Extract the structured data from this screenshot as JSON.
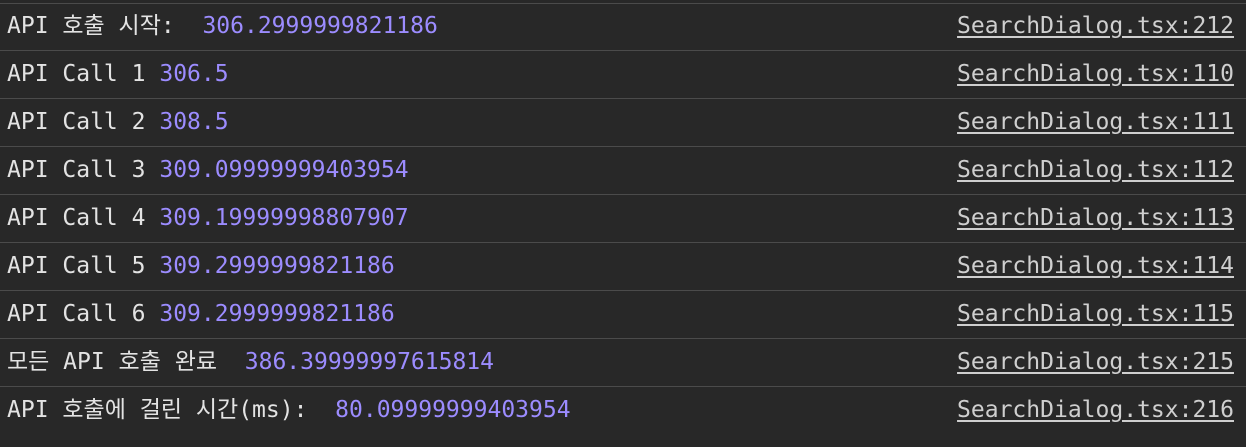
{
  "console": {
    "rows": [
      {
        "label": "API 호출 시작: ",
        "value": "306.2999999821186",
        "source": "SearchDialog.tsx:212"
      },
      {
        "label": "API Call 1",
        "value": "306.5",
        "source": "SearchDialog.tsx:110"
      },
      {
        "label": "API Call 2",
        "value": "308.5",
        "source": "SearchDialog.tsx:111"
      },
      {
        "label": "API Call 3",
        "value": "309.09999999403954",
        "source": "SearchDialog.tsx:112"
      },
      {
        "label": "API Call 4",
        "value": "309.19999998807907",
        "source": "SearchDialog.tsx:113"
      },
      {
        "label": "API Call 5",
        "value": "309.2999999821186",
        "source": "SearchDialog.tsx:114"
      },
      {
        "label": "API Call 6",
        "value": "309.2999999821186",
        "source": "SearchDialog.tsx:115"
      },
      {
        "label": "모든 API 호출 완료 ",
        "value": "386.39999997615814",
        "source": "SearchDialog.tsx:215"
      },
      {
        "label": "API 호출에 걸린 시간(ms): ",
        "value": "80.09999999403954",
        "source": "SearchDialog.tsx:216"
      }
    ]
  },
  "colors": {
    "background": "#282828",
    "text": "#e3e3e3",
    "number": "#9c8cff",
    "link": "#cfcfcf",
    "divider": "#4b4b4b"
  }
}
